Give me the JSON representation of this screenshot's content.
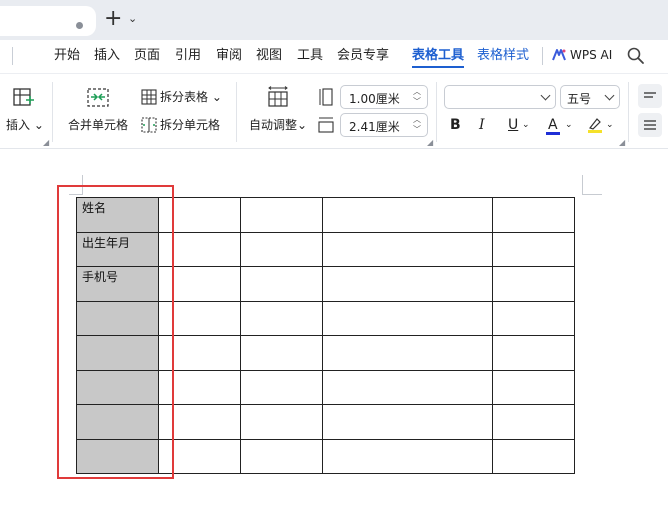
{
  "tabstrip": {
    "new_tab": "+",
    "menu_chevron": "⌄"
  },
  "menu": {
    "items": [
      "开始",
      "插入",
      "页面",
      "引用",
      "审阅",
      "视图",
      "工具",
      "会员专享",
      "表格工具",
      "表格样式"
    ],
    "active": "表格工具",
    "ai_label": "WPS AI"
  },
  "ribbon": {
    "insert_label": "插入",
    "merge_label": "合并单元格",
    "split_table_label": "拆分表格",
    "split_cell_label": "拆分单元格",
    "autofit_label": "自动调整",
    "row_height": "1.00厘米",
    "col_width": "2.41厘米",
    "font_name": "",
    "font_size": "五号",
    "bold": "B",
    "italic": "I",
    "underline": "U",
    "font_color": "A",
    "highlight_color": "#f5e12a",
    "font_color_bar": "#1f2fd6"
  },
  "table": {
    "rows": [
      [
        "姓名",
        "",
        "",
        "",
        ""
      ],
      [
        "出生年月",
        "",
        "",
        "",
        ""
      ],
      [
        "手机号",
        "",
        "",
        "",
        ""
      ],
      [
        "",
        "",
        "",
        "",
        ""
      ],
      [
        "",
        "",
        "",
        "",
        ""
      ],
      [
        "",
        "",
        "",
        "",
        ""
      ],
      [
        "",
        "",
        "",
        "",
        ""
      ],
      [
        "",
        "",
        "",
        "",
        ""
      ]
    ]
  },
  "colors": {
    "accent": "#1d5fd0",
    "selection_outline": "#e03a3a",
    "selected_fill": "#c8c8c8"
  }
}
